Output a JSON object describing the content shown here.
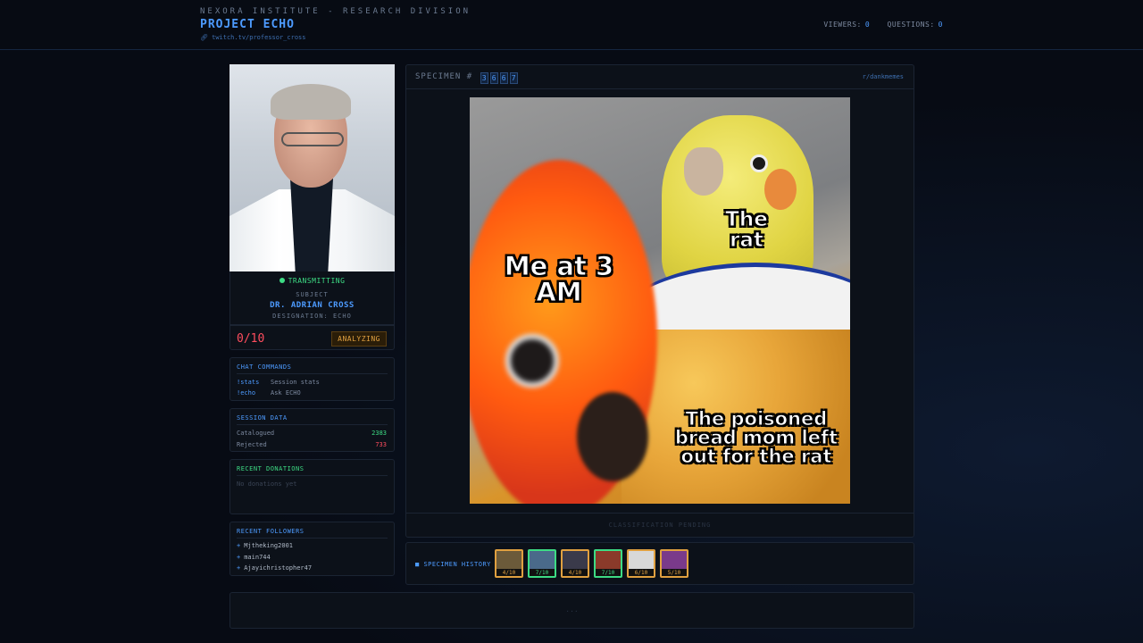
{
  "header": {
    "institute": "NEXORA INSTITUTE - RESEARCH DIVISION",
    "title": "PROJECT ECHO",
    "link": "twitch.tv/professor_cross",
    "viewers_label": "VIEWERS:",
    "viewers": "0",
    "questions_label": "QUESTIONS:",
    "questions": "0"
  },
  "subject": {
    "status": "TRANSMITTING",
    "label": "SUBJECT",
    "name": "DR. ADRIAN CROSS",
    "designation": "DESIGNATION: ECHO",
    "score": "0/10",
    "state": "ANALYZING"
  },
  "commands": {
    "title": "CHAT COMMANDS",
    "items": [
      {
        "cmd": "!stats",
        "desc": "Session stats"
      },
      {
        "cmd": "!echo",
        "desc": "Ask ECHO"
      }
    ]
  },
  "session": {
    "title": "SESSION DATA",
    "catalogued_label": "Catalogued",
    "catalogued": "2383",
    "rejected_label": "Rejected",
    "rejected": "733"
  },
  "donations": {
    "title": "RECENT DONATIONS",
    "empty": "No donations yet"
  },
  "followers": {
    "title": "RECENT FOLLOWERS",
    "items": [
      "Mjtheking2001",
      "main744",
      "Ajayichristopher47"
    ]
  },
  "specimen": {
    "label": "SPECIMEN #",
    "digits": [
      "3",
      "6",
      "6",
      "7"
    ],
    "source": "r/dankmemes",
    "captions": [
      "Me at 3 AM",
      "The rat",
      "The poisoned bread mom left out for the rat"
    ],
    "footer": "CLASSIFICATION PENDING"
  },
  "history": {
    "title": "SPECIMEN HISTORY",
    "items": [
      {
        "score": "4/10",
        "tier": "mid",
        "color": "#6b5a3a"
      },
      {
        "score": "7/10",
        "tier": "good",
        "color": "#4a6a8a"
      },
      {
        "score": "4/10",
        "tier": "mid",
        "color": "#3a3a4a"
      },
      {
        "score": "7/10",
        "tier": "good",
        "color": "#8a3a2a"
      },
      {
        "score": "6/10",
        "tier": "mid",
        "color": "#d8d8d8"
      },
      {
        "score": "5/10",
        "tier": "mid",
        "color": "#7a3a8a"
      }
    ]
  },
  "bottom": {
    "placeholder": "..."
  }
}
